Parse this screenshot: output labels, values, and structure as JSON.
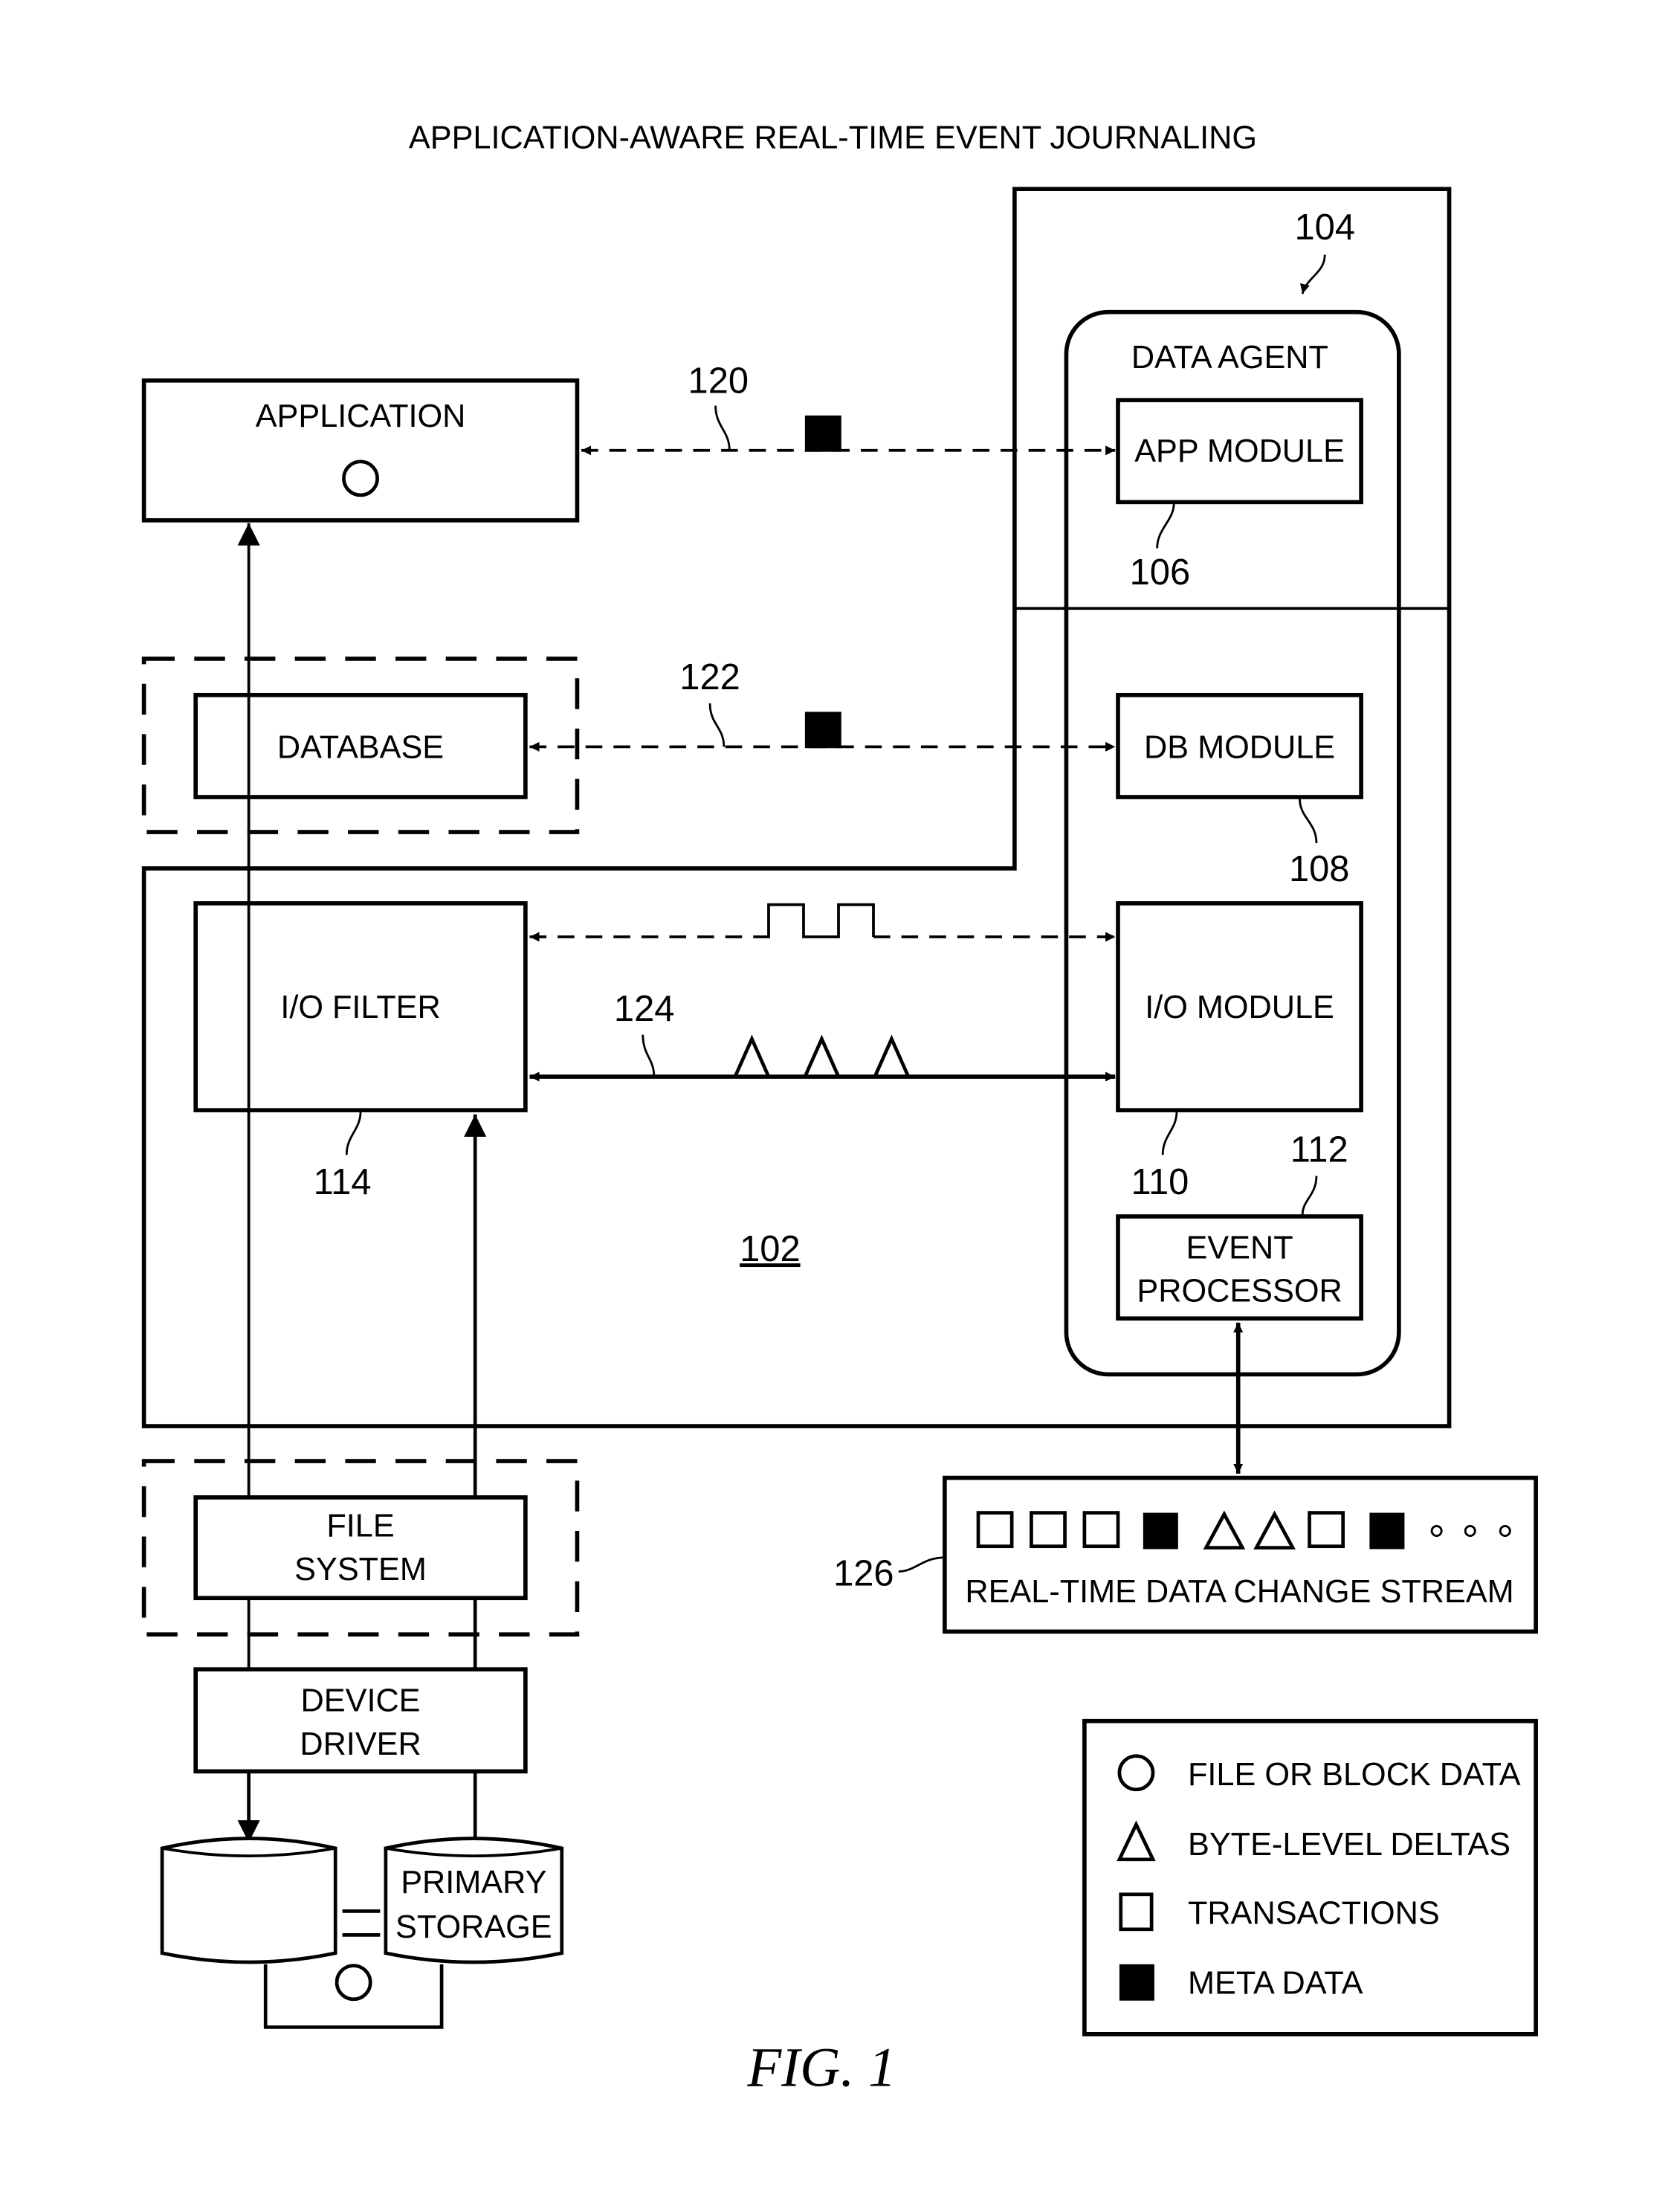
{
  "title": "APPLICATION-AWARE REAL-TIME EVENT JOURNALING",
  "figure_label": "FIG. 1",
  "components": {
    "application": "APPLICATION",
    "database": "DATABASE",
    "io_filter": "I/O FILTER",
    "file_system": [
      "FILE",
      "SYSTEM"
    ],
    "device_driver": [
      "DEVICE",
      "DRIVER"
    ],
    "primary_storage": [
      "PRIMARY",
      "STORAGE"
    ],
    "data_agent": "DATA AGENT",
    "app_module": "APP MODULE",
    "db_module": "DB MODULE",
    "io_module": "I/O MODULE",
    "event_processor": [
      "EVENT",
      "PROCESSOR"
    ],
    "stream": "REAL-TIME DATA CHANGE STREAM"
  },
  "refs": {
    "r102": "102",
    "r104": "104",
    "r106": "106",
    "r108": "108",
    "r110": "110",
    "r112": "112",
    "r114": "114",
    "r120": "120",
    "r122": "122",
    "r124": "124",
    "r126": "126"
  },
  "stream_symbols": [
    "transaction",
    "transaction",
    "transaction",
    "meta-data",
    "byte-delta",
    "byte-delta",
    "transaction",
    "meta-data",
    "ellipsis"
  ],
  "legend": [
    {
      "symbol": "circle",
      "label": "FILE OR BLOCK DATA"
    },
    {
      "symbol": "triangle",
      "label": "BYTE-LEVEL DELTAS"
    },
    {
      "symbol": "open-square",
      "label": "TRANSACTIONS"
    },
    {
      "symbol": "filled-square",
      "label": "META DATA"
    }
  ]
}
